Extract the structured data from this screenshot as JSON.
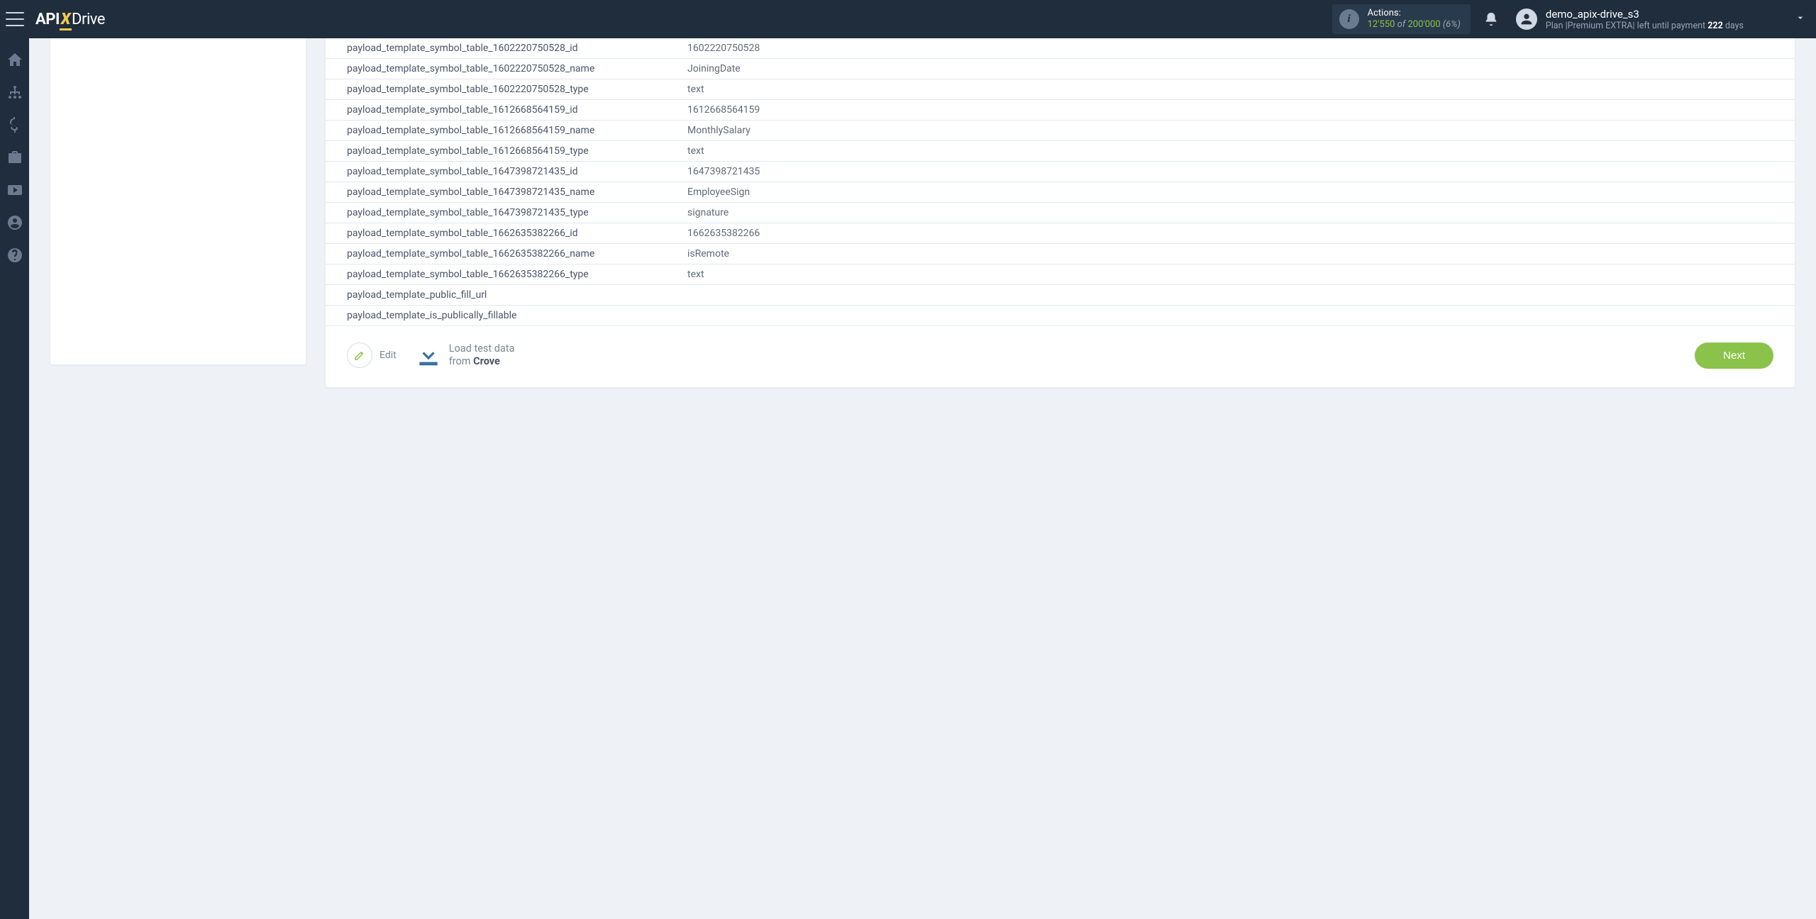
{
  "header": {
    "actions": {
      "label": "Actions:",
      "used": "12'550",
      "of": "of",
      "total": "200'000",
      "pct": "(6%)"
    },
    "user": {
      "name": "demo_apix-drive_s3",
      "plan_prefix": "Plan |",
      "plan_name": "Premium EXTRA",
      "plan_mid": "| left until payment ",
      "days_num": "222",
      "days_suffix": " days"
    }
  },
  "table": {
    "rows": [
      {
        "key": "payload_template_symbol_table_1602220750528_id",
        "val": "1602220750528"
      },
      {
        "key": "payload_template_symbol_table_1602220750528_name",
        "val": "JoiningDate"
      },
      {
        "key": "payload_template_symbol_table_1602220750528_type",
        "val": "text"
      },
      {
        "key": "payload_template_symbol_table_1612668564159_id",
        "val": "1612668564159"
      },
      {
        "key": "payload_template_symbol_table_1612668564159_name",
        "val": "MonthlySalary"
      },
      {
        "key": "payload_template_symbol_table_1612668564159_type",
        "val": "text"
      },
      {
        "key": "payload_template_symbol_table_1647398721435_id",
        "val": "1647398721435"
      },
      {
        "key": "payload_template_symbol_table_1647398721435_name",
        "val": "EmployeeSign"
      },
      {
        "key": "payload_template_symbol_table_1647398721435_type",
        "val": "signature"
      },
      {
        "key": "payload_template_symbol_table_1662635382266_id",
        "val": "1662635382266"
      },
      {
        "key": "payload_template_symbol_table_1662635382266_name",
        "val": "isRemote"
      },
      {
        "key": "payload_template_symbol_table_1662635382266_type",
        "val": "text"
      },
      {
        "key": "payload_template_public_fill_url",
        "val": ""
      },
      {
        "key": "payload_template_is_publically_fillable",
        "val": ""
      }
    ]
  },
  "footer": {
    "edit": "Edit",
    "load_line1": "Load test data",
    "load_line2_from": "from ",
    "load_line2_source": "Crove",
    "next": "Next"
  },
  "logo": {
    "api": "API",
    "x": "X",
    "drive": "Drive"
  }
}
